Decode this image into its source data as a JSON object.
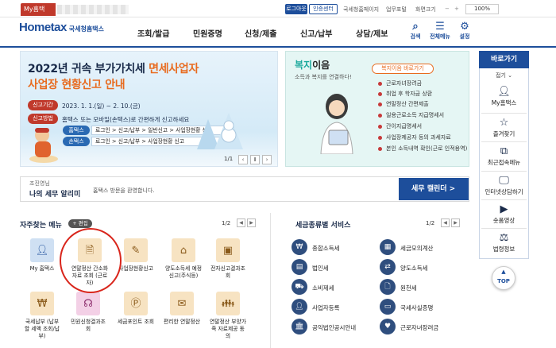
{
  "topbar": {
    "myhome_tab": "My홈택",
    "logout": "로그아웃",
    "cert_center": "인증센터",
    "links": [
      "국세청홈페이지",
      "업무포털",
      "화면크기"
    ],
    "zoom": "100%"
  },
  "gnb": {
    "logo_text": "Hometax",
    "logo_sub": "국세청홈택스",
    "menus": [
      "조회/발급",
      "민원증명",
      "신청/제출",
      "신고/납부",
      "상담/제보"
    ],
    "right_icons": [
      {
        "label": "검색",
        "icon": "search-icon"
      },
      {
        "label": "전체메뉴",
        "icon": "menu-grid-icon"
      },
      {
        "label": "설정",
        "icon": "gear-icon"
      }
    ]
  },
  "banner": {
    "title_line1_a": "2022년 귀속 부가가치세 ",
    "title_line1_b": "면세사업자",
    "title_line2": "사업장 현황신고 안내",
    "period_label": "신고기간",
    "period_value": "2023. 1. 1.(일) ~ 2. 10.(금)",
    "method_label": "신고방법",
    "method_value": "홈택스 또는 모바일(손택스)로 간편하게 신고하세요",
    "hometax_chip": "홈택스",
    "hometax_path": "로그인 > 신고/납부 > 일반신고 > 사업장현황 신고",
    "sontax_chip": "손택스",
    "sontax_path": "로그인 > 신고/납부 > 사업장현황 신고",
    "pager": "1/1"
  },
  "welfare": {
    "title_a": "복지",
    "title_b": "이음",
    "subtitle": "소득과 복지를 연결하다!",
    "shortcut_button": "복지이음 바로가기",
    "items": [
      "근로자녀장려금",
      "취업 후 학자금 상환",
      "연말정산 간편제출",
      "일용근로소득 지급명세서",
      "간이지급명세서",
      "사업장제공자 등의 과세자료",
      "본인 소득내역 확인(근로 인적용역)"
    ]
  },
  "sidebar": {
    "header": "바로가기",
    "fold": "접기",
    "items": [
      {
        "label": "My홈택스",
        "icon": "user-icon"
      },
      {
        "label": "즐겨찾기",
        "icon": "star-icon"
      },
      {
        "label": "최근접속메뉴",
        "icon": "recent-icon"
      },
      {
        "label": "인터넷상담하기",
        "icon": "monitor-icon"
      },
      {
        "label": "숏폼영상",
        "icon": "video-icon"
      },
      {
        "label": "법령정보",
        "icon": "gavel-icon"
      }
    ],
    "top_button": "TOP"
  },
  "greeting": {
    "name": "조진영님",
    "title": "나의 세무 알리미",
    "message": "홈택스 방문을 환영합니다.",
    "calendar_button": "세무 캘린더 >"
  },
  "favorites": {
    "title": "자주찾는 메뉴",
    "edit": "+ 편집",
    "pager": "1/2",
    "items": [
      {
        "label": "My 홈택스",
        "icon": "user-icon",
        "style": "blue"
      },
      {
        "label": "연말정산 간소화 자료 조회 (근로자)",
        "icon": "document-icon",
        "style": "tan"
      },
      {
        "label": "사업장현황신고",
        "icon": "form-icon",
        "style": "tan"
      },
      {
        "label": "양도소득세 예정신고(주식등)",
        "icon": "house-icon",
        "style": "tan"
      },
      {
        "label": "전자신고결과조회",
        "icon": "inbox-icon",
        "style": "tan"
      },
      {
        "label": "국세납부 (납부할 세액 조회/납부)",
        "icon": "pay-icon",
        "style": "tan"
      },
      {
        "label": "민원신청결과조회",
        "icon": "headset-icon",
        "style": "pink"
      },
      {
        "label": "세금포인트 조회",
        "icon": "point-icon",
        "style": "tan"
      },
      {
        "label": "편리한 연말정산",
        "icon": "mail-icon",
        "style": "tan"
      },
      {
        "label": "연말정산 부양가족 자료제공 동의",
        "icon": "family-icon",
        "style": "tan"
      }
    ]
  },
  "tax_services": {
    "title": "세금종류별 서비스",
    "pager": "1/2",
    "items": [
      "종합소득세",
      "세금모의계산",
      "법인세",
      "양도소득세",
      "소비제세",
      "원천세",
      "사업자등록",
      "국세사실증명",
      "공익법인공시안내",
      "근로자녀장려금"
    ]
  }
}
